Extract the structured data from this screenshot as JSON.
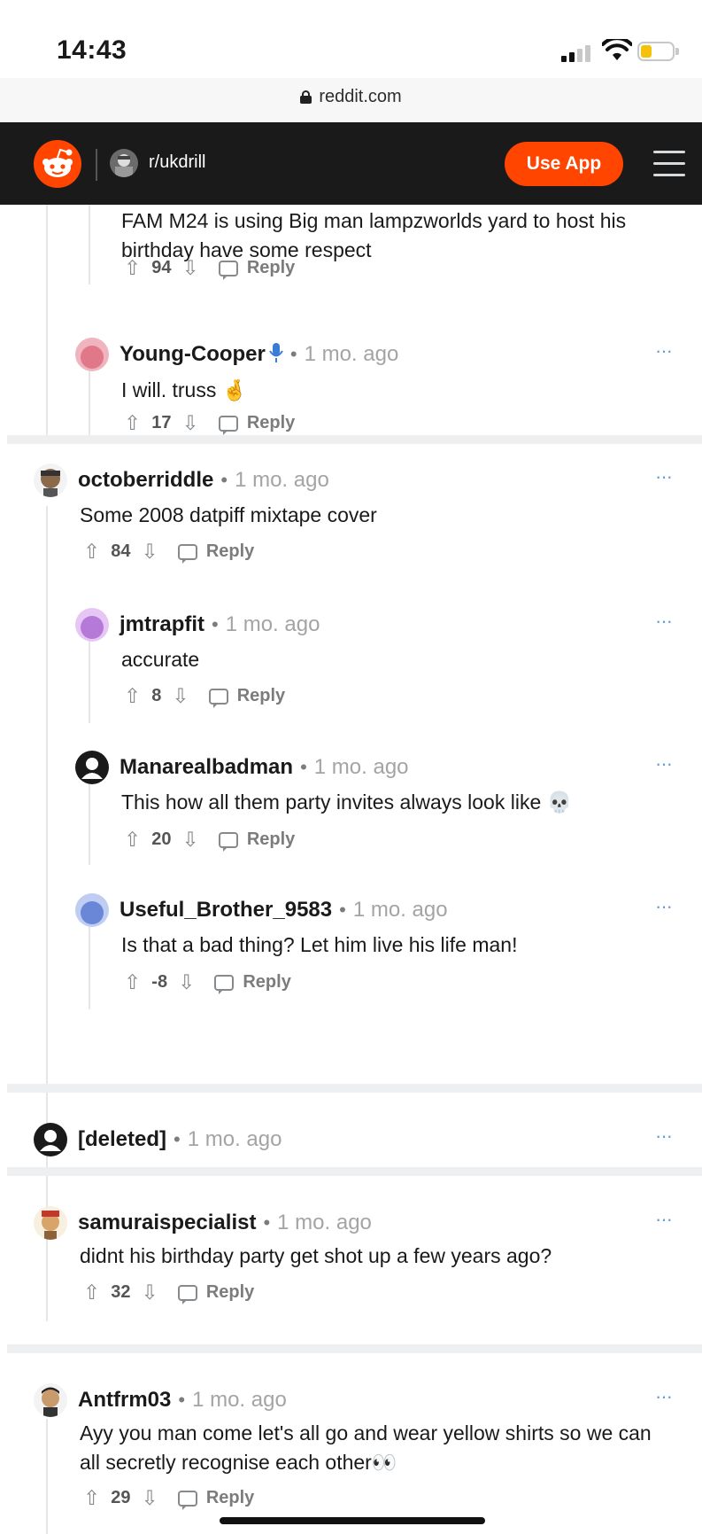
{
  "status_bar": {
    "time": "14:43"
  },
  "browser": {
    "url": "reddit.com"
  },
  "header": {
    "subreddit": "r/ukdrill",
    "use_app_label": "Use App"
  },
  "colors": {
    "accent": "#ff4500",
    "header_bg": "#1a1a1b",
    "more_dots": "#6a9bd8"
  },
  "comments": [
    {
      "author": "",
      "age": "",
      "body": "FAM M24 is using Big man lampzworlds yard to host his birthday have some respect",
      "score": "94",
      "reply": "Reply"
    },
    {
      "author": "Young-Cooper",
      "age": "1 mo. ago",
      "body": "I will. truss 🤞",
      "score": "17",
      "reply": "Reply",
      "avatar_color": "#e58a9a",
      "badge_icon": "microphone-icon"
    },
    {
      "author": "octoberriddle",
      "age": "1 mo. ago",
      "body": "Some 2008 datpiff mixtape cover",
      "score": "84",
      "reply": "Reply"
    },
    {
      "author": "jmtrapfit",
      "age": "1 mo. ago",
      "body": "accurate",
      "score": "8",
      "reply": "Reply",
      "avatar_color": "#c88ee6"
    },
    {
      "author": "Manarealbadman",
      "age": "1 mo. ago",
      "body": "This how all them party invites always look like 💀",
      "score": "20",
      "reply": "Reply"
    },
    {
      "author": "Useful_Brother_9583",
      "age": "1 mo. ago",
      "body": "Is that a bad thing? Let him live his life man!",
      "score": "-8",
      "reply": "Reply",
      "avatar_color": "#7f9ae0"
    },
    {
      "author": "[deleted]",
      "age": "1 mo. ago"
    },
    {
      "author": "samuraispecialist",
      "age": "1 mo. ago",
      "body": "didnt his birthday party get shot up a few years ago?",
      "score": "32",
      "reply": "Reply"
    },
    {
      "author": "Antfrm03",
      "age": "1 mo. ago",
      "body": "Ayy you man come let's all go and wear yellow shirts so we can all secretly recognise each other👀",
      "score": "29",
      "reply": "Reply"
    }
  ],
  "separator": "•",
  "more_icon": "···"
}
